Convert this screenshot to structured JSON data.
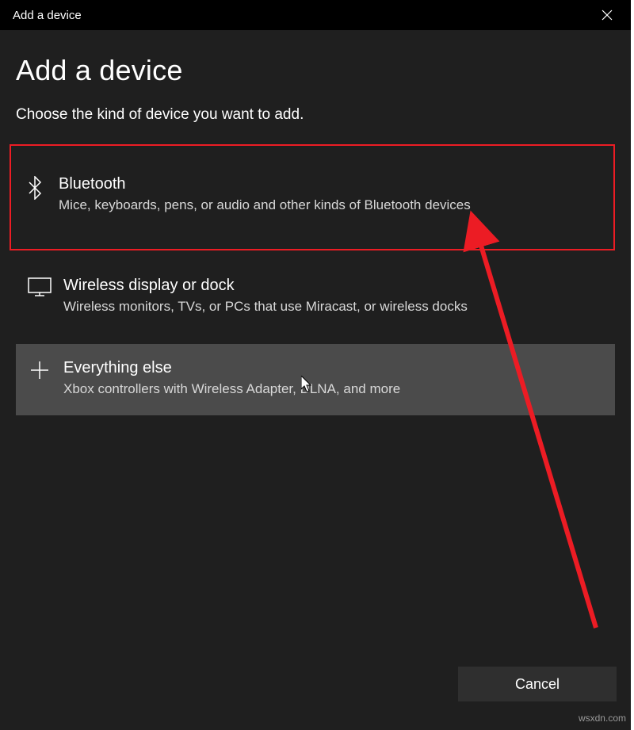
{
  "titlebar": {
    "title": "Add a device"
  },
  "page": {
    "heading": "Add a device",
    "subtitle": "Choose the kind of device you want to add."
  },
  "options": [
    {
      "title": "Bluetooth",
      "desc": "Mice, keyboards, pens, or audio and other kinds of Bluetooth devices"
    },
    {
      "title": "Wireless display or dock",
      "desc": "Wireless monitors, TVs, or PCs that use Miracast, or wireless docks"
    },
    {
      "title": "Everything else",
      "desc": "Xbox controllers with Wireless Adapter, DLNA, and more"
    }
  ],
  "footer": {
    "cancel": "Cancel"
  },
  "watermark": "wsxdn.com",
  "annotation": {
    "highlight_color": "#ec1c24"
  }
}
